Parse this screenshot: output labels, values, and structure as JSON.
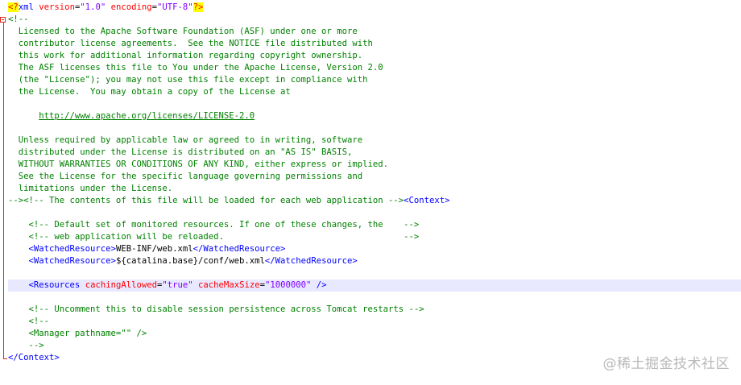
{
  "editor": {
    "folds": {
      "open_line": 1,
      "close_line": 29
    },
    "highlighted_line": 23,
    "lines": [
      [
        {
          "t": "pi",
          "v": "<?"
        },
        {
          "t": "tag",
          "v": "xml"
        },
        {
          "t": "txt",
          "v": " "
        },
        {
          "t": "attr",
          "v": "version"
        },
        {
          "t": "txt",
          "v": "="
        },
        {
          "t": "val",
          "v": "\"1.0\""
        },
        {
          "t": "txt",
          "v": " "
        },
        {
          "t": "attr",
          "v": "encoding"
        },
        {
          "t": "txt",
          "v": "="
        },
        {
          "t": "val",
          "v": "\"UTF-8\""
        },
        {
          "t": "pi",
          "v": "?>"
        }
      ],
      [
        {
          "t": "c",
          "v": "<!--"
        }
      ],
      [
        {
          "t": "c",
          "v": "  Licensed to the Apache Software Foundation (ASF) under one or more"
        }
      ],
      [
        {
          "t": "c",
          "v": "  contributor license agreements.  See the NOTICE file distributed with"
        }
      ],
      [
        {
          "t": "c",
          "v": "  this work for additional information regarding copyright ownership."
        }
      ],
      [
        {
          "t": "c",
          "v": "  The ASF licenses this file to You under the Apache License, Version 2.0"
        }
      ],
      [
        {
          "t": "c",
          "v": "  (the \"License\"); you may not use this file except in compliance with"
        }
      ],
      [
        {
          "t": "c",
          "v": "  the License.  You may obtain a copy of the License at"
        }
      ],
      [
        {
          "t": "c",
          "v": ""
        }
      ],
      [
        {
          "t": "c",
          "v": "      "
        },
        {
          "t": "link",
          "v": "http://www.apache.org/licenses/LICENSE-2.0"
        }
      ],
      [
        {
          "t": "c",
          "v": ""
        }
      ],
      [
        {
          "t": "c",
          "v": "  Unless required by applicable law or agreed to in writing, software"
        }
      ],
      [
        {
          "t": "c",
          "v": "  distributed under the License is distributed on an \"AS IS\" BASIS,"
        }
      ],
      [
        {
          "t": "c",
          "v": "  WITHOUT WARRANTIES OR CONDITIONS OF ANY KIND, either express or implied."
        }
      ],
      [
        {
          "t": "c",
          "v": "  See the License for the specific language governing permissions and"
        }
      ],
      [
        {
          "t": "c",
          "v": "  limitations under the License."
        }
      ],
      [
        {
          "t": "c",
          "v": "--><!-- The contents of this file will be loaded for each web application -->"
        },
        {
          "t": "tag",
          "v": "<Context>"
        }
      ],
      [
        {
          "t": "txt",
          "v": ""
        }
      ],
      [
        {
          "t": "c",
          "v": "    <!-- Default set of monitored resources. If one of these changes, the    -->"
        }
      ],
      [
        {
          "t": "c",
          "v": "    <!-- web application will be reloaded.                                   -->"
        }
      ],
      [
        {
          "t": "txt",
          "v": "    "
        },
        {
          "t": "tag",
          "v": "<WatchedResource>"
        },
        {
          "t": "txt",
          "v": "WEB-INF/web.xml"
        },
        {
          "t": "tag",
          "v": "</WatchedResource>"
        }
      ],
      [
        {
          "t": "txt",
          "v": "    "
        },
        {
          "t": "tag",
          "v": "<WatchedResource>"
        },
        {
          "t": "txt",
          "v": "${catalina.base}/conf/web.xml"
        },
        {
          "t": "tag",
          "v": "</WatchedResource>"
        }
      ],
      [
        {
          "t": "txt",
          "v": ""
        }
      ],
      [
        {
          "t": "txt",
          "v": "    "
        },
        {
          "t": "tag",
          "v": "<Resources"
        },
        {
          "t": "txt",
          "v": " "
        },
        {
          "t": "attr",
          "v": "cachingAllowed"
        },
        {
          "t": "txt",
          "v": "="
        },
        {
          "t": "val",
          "v": "\"true\""
        },
        {
          "t": "txt",
          "v": " "
        },
        {
          "t": "attr",
          "v": "cacheMaxSize"
        },
        {
          "t": "txt",
          "v": "="
        },
        {
          "t": "val",
          "v": "\"1000000\""
        },
        {
          "t": "txt",
          "v": " "
        },
        {
          "t": "tag",
          "v": "/>"
        }
      ],
      [
        {
          "t": "txt",
          "v": ""
        }
      ],
      [
        {
          "t": "c",
          "v": "    <!-- Uncomment this to disable session persistence across Tomcat restarts -->"
        }
      ],
      [
        {
          "t": "c",
          "v": "    <!--"
        }
      ],
      [
        {
          "t": "c",
          "v": "    <Manager pathname=\"\" />"
        }
      ],
      [
        {
          "t": "c",
          "v": "    -->"
        }
      ],
      [
        {
          "t": "tag",
          "v": "</Context>"
        }
      ]
    ]
  },
  "watermark": "@稀土掘金技术社区"
}
